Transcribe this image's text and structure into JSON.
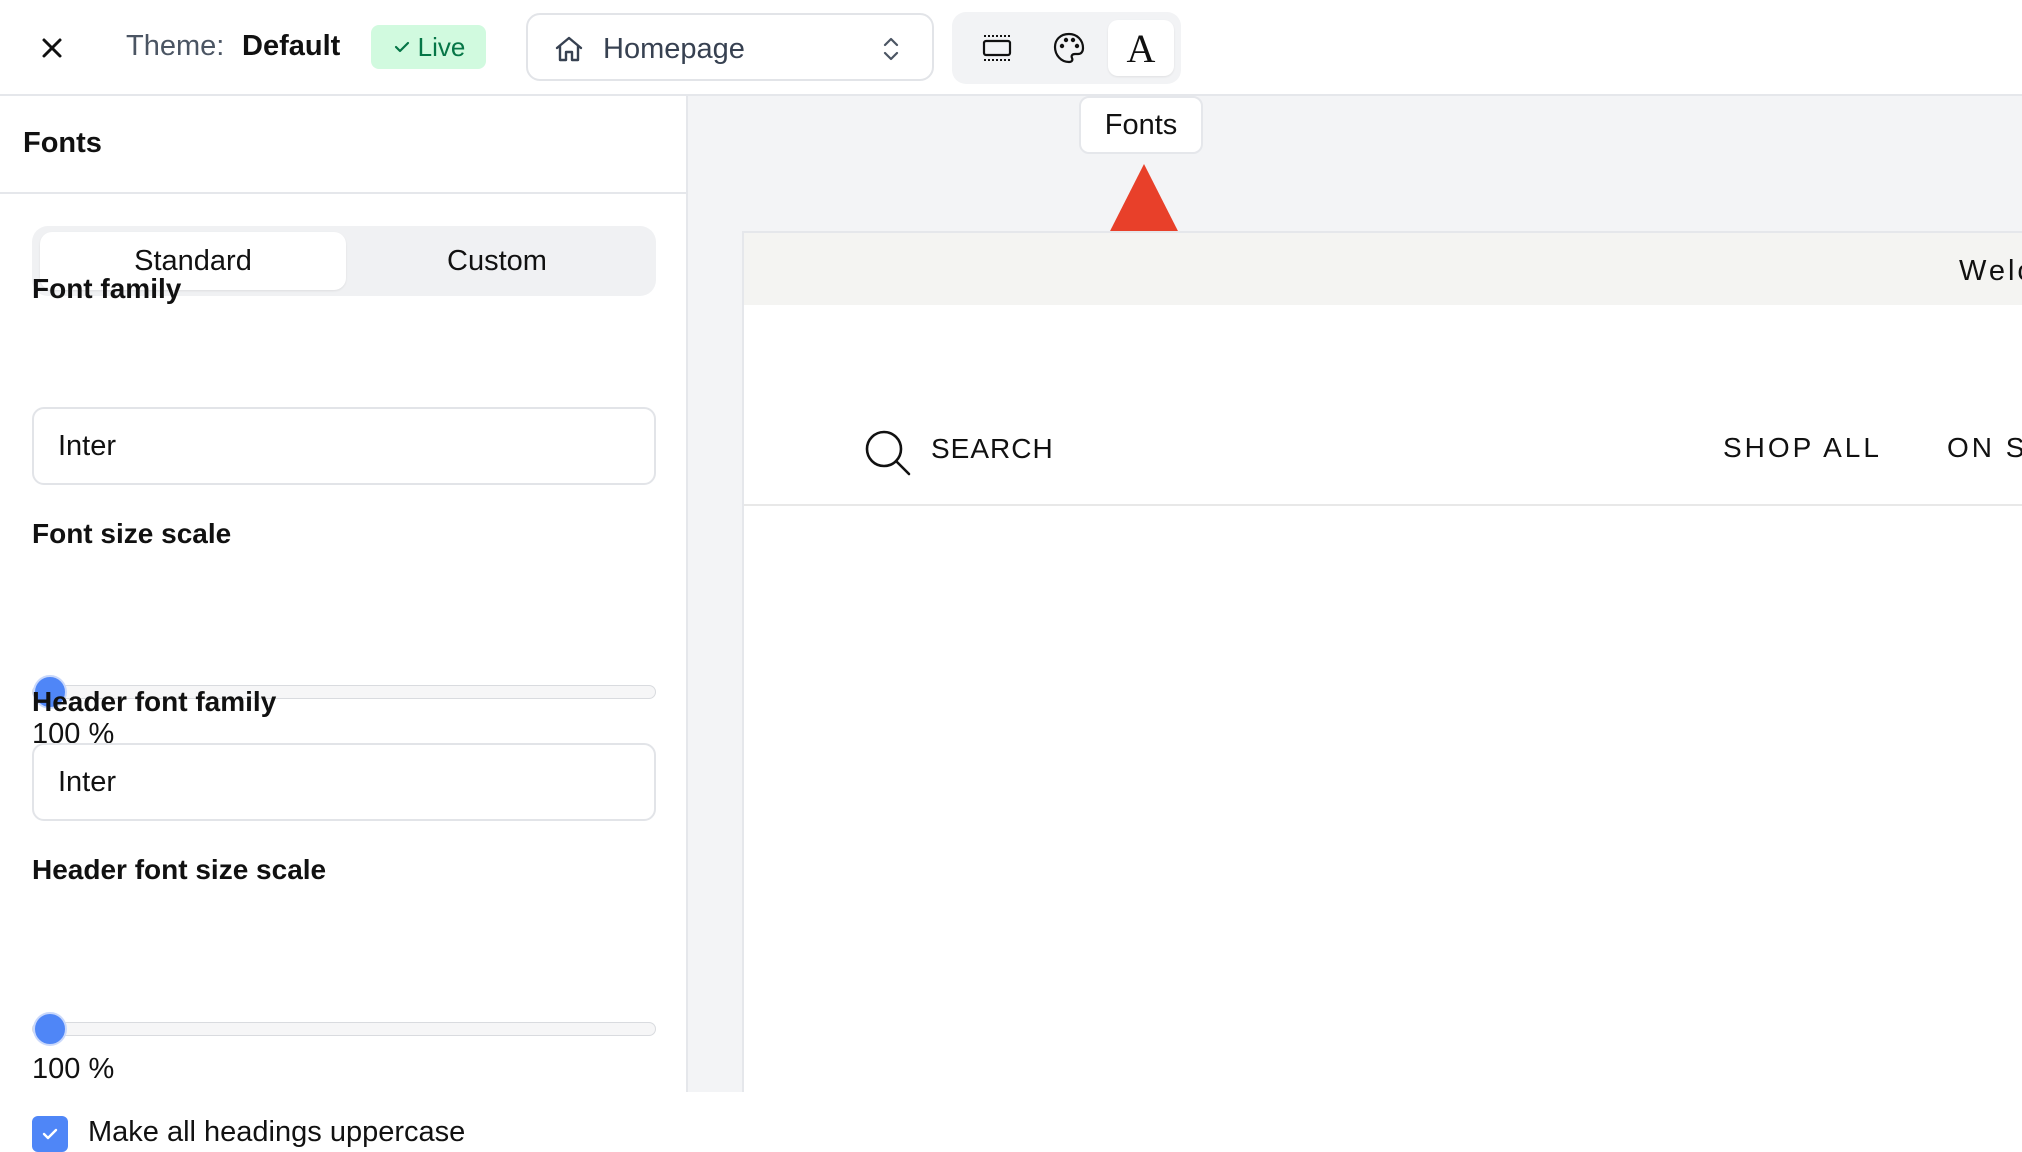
{
  "topbar": {
    "close_icon": "close-icon",
    "theme_label": "Theme:",
    "theme_name": "Default",
    "live_badge": "Live",
    "page_select": {
      "value": "Homepage",
      "icon": "home-icon",
      "chevron": "chevron-up-down-icon"
    },
    "tools": [
      {
        "name": "layout-sections",
        "icon": "layout-icon"
      },
      {
        "name": "colors",
        "icon": "palette-icon"
      },
      {
        "name": "fonts",
        "icon": "font-icon",
        "glyph": "A",
        "active": true
      }
    ]
  },
  "sidebar": {
    "title": "Fonts",
    "segmented": {
      "options": [
        "Standard",
        "Custom"
      ],
      "selected": "Standard"
    },
    "font_family": {
      "label": "Font family",
      "value": "Inter"
    },
    "font_size_scale": {
      "label": "Font size scale",
      "value_text": "100 %",
      "level": 0
    },
    "header_font_family": {
      "label": "Header font family",
      "value": "Inter"
    },
    "header_font_size_scale": {
      "label": "Header font size scale",
      "value_text": "100 %",
      "level": 0
    },
    "uppercase_headings": {
      "label": "Make all headings uppercase",
      "checked": true
    }
  },
  "tooltip": {
    "text": "Fonts"
  },
  "preview": {
    "announcement": "Welc",
    "nav": {
      "search_label": "SEARCH",
      "shop_all": "SHOP ALL",
      "on_sale": "ON S"
    }
  },
  "colors": {
    "accent": "#4f86f7",
    "live_bg": "#d1fadf",
    "live_text": "#067647",
    "arrow": "#e8402a",
    "canvas_bg": "#f3f4f6"
  }
}
